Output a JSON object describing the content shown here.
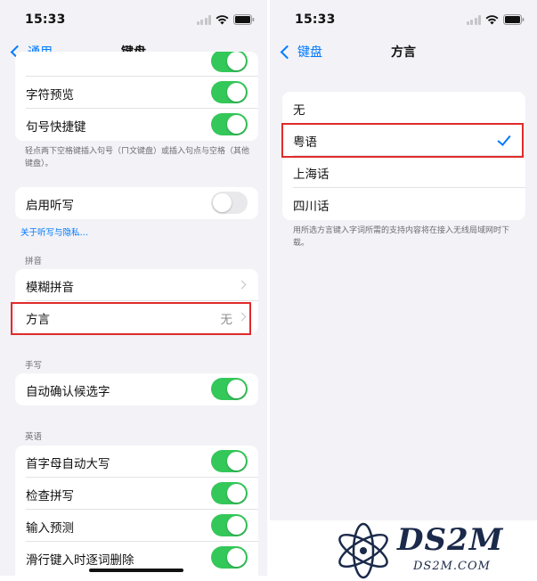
{
  "status_bar": {
    "time": "15:33"
  },
  "left": {
    "nav": {
      "back_label": "通用",
      "title": "键盘"
    },
    "group1": {
      "items": [
        {
          "label": "字符预览"
        },
        {
          "label": "句号快捷键"
        }
      ]
    },
    "group1_footer": "轻点两下空格键插入句号（ㄇ文键盘）或插入句点与空格（其他键盘）。",
    "dictation": {
      "label": "启用听写"
    },
    "dictation_link": "关于听写与隐私…",
    "pinyin_header": "拼音",
    "pinyin": {
      "fuzzy_label": "模糊拼音",
      "dialect_label": "方言",
      "dialect_value": "无"
    },
    "handwriting_header": "手写",
    "handwriting": {
      "label": "自动确认候选字"
    },
    "english_header": "英语",
    "english": {
      "items": [
        {
          "label": "首字母自动大写"
        },
        {
          "label": "检查拼写"
        },
        {
          "label": "输入预测"
        },
        {
          "label": "滑行键入时逐词删除"
        }
      ]
    }
  },
  "right": {
    "status_time": "15:33",
    "nav": {
      "back_label": "键盘",
      "title": "方言"
    },
    "options": [
      {
        "label": "无"
      },
      {
        "label": "粤语"
      },
      {
        "label": "上海话"
      },
      {
        "label": "四川话"
      }
    ],
    "selected": "粤语",
    "footer": "用所选方言键入字词所需的支持内容将在接入无线局域网时下载。"
  },
  "watermark": {
    "brand": "DS2M",
    "domain": "DS2M.COM"
  },
  "colors": {
    "accent": "#007aff",
    "switch_on": "#34c759",
    "highlight": "#e02b2b"
  }
}
